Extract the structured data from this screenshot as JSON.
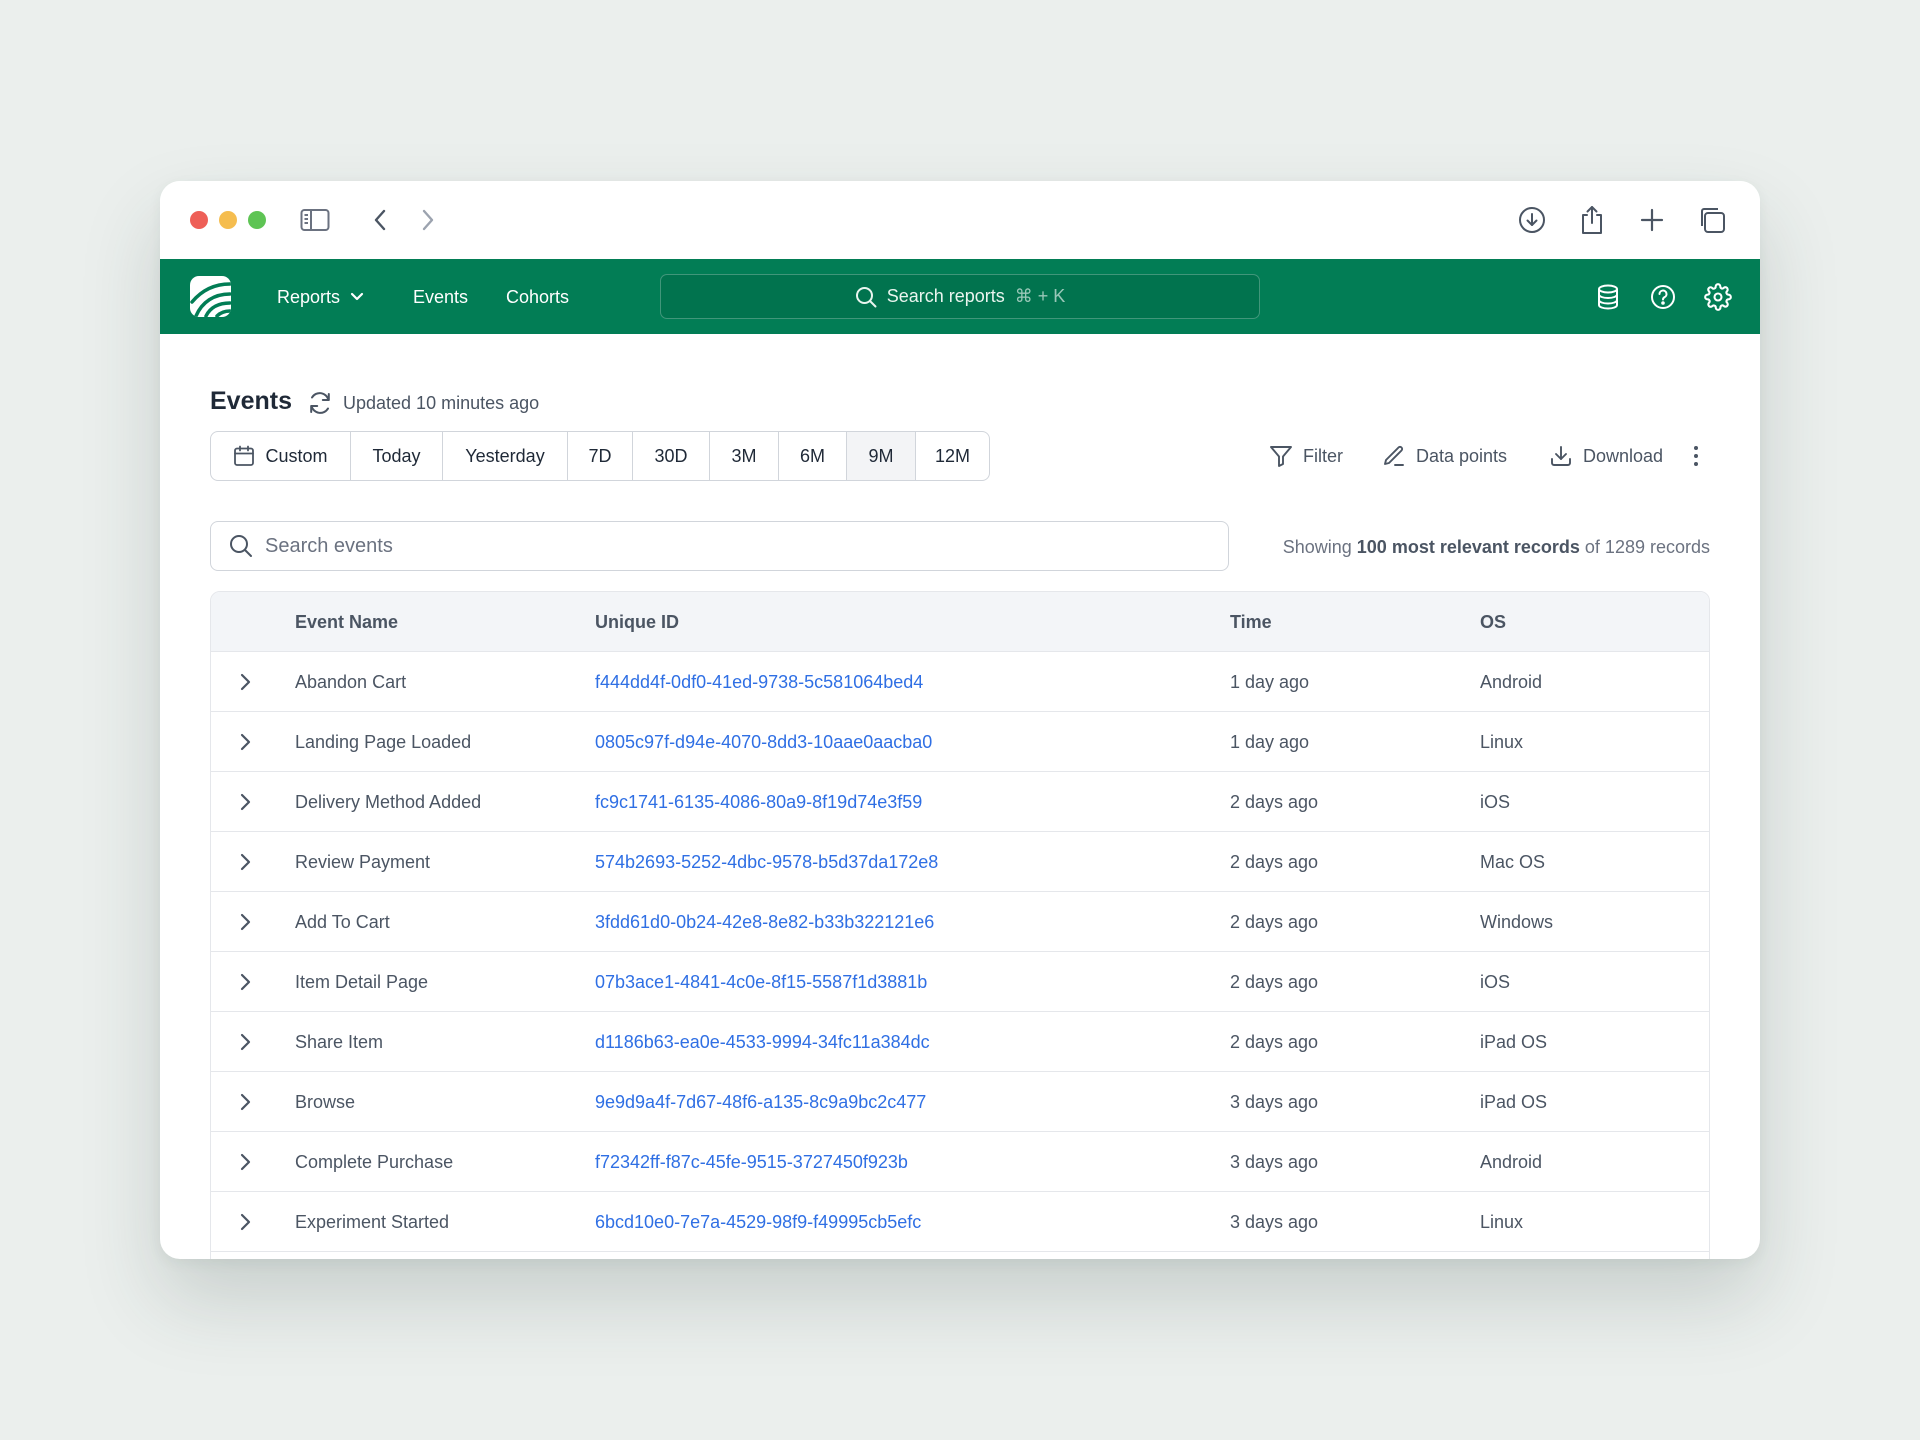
{
  "app": {
    "nav": {
      "reports_label": "Reports",
      "events_label": "Events",
      "cohorts_label": "Cohorts",
      "search_placeholder": "Search reports",
      "search_shortcut": "⌘ + K"
    },
    "brand_color": "#027d55"
  },
  "page": {
    "title": "Events",
    "updated_text": "Updated 10 minutes ago"
  },
  "date_ranges": [
    {
      "label": "Custom",
      "active": false
    },
    {
      "label": "Today",
      "active": false
    },
    {
      "label": "Yesterday",
      "active": false
    },
    {
      "label": "7D",
      "active": false
    },
    {
      "label": "30D",
      "active": false
    },
    {
      "label": "3M",
      "active": false
    },
    {
      "label": "6M",
      "active": false
    },
    {
      "label": "9M",
      "active": true
    },
    {
      "label": "12M",
      "active": false
    }
  ],
  "toolbar": {
    "filter_label": "Filter",
    "data_points_label": "Data points",
    "download_label": "Download"
  },
  "event_search": {
    "placeholder": "Search events"
  },
  "showing": {
    "prefix": "Showing",
    "emphasis": "100 most relevant records",
    "suffix": "of 1289 records"
  },
  "table": {
    "columns": {
      "event_name": "Event Name",
      "unique_id": "Unique ID",
      "time": "Time",
      "os": "OS"
    },
    "rows": [
      {
        "event": "Abandon Cart",
        "id": "f444dd4f-0df0-41ed-9738-5c581064bed4",
        "time": "1 day ago",
        "os": "Android"
      },
      {
        "event": "Landing Page Loaded",
        "id": "0805c97f-d94e-4070-8dd3-10aae0aacba0",
        "time": "1 day ago",
        "os": "Linux"
      },
      {
        "event": "Delivery Method Added",
        "id": "fc9c1741-6135-4086-80a9-8f19d74e3f59",
        "time": "2 days ago",
        "os": "iOS"
      },
      {
        "event": "Review Payment",
        "id": "574b2693-5252-4dbc-9578-b5d37da172e8",
        "time": "2 days ago",
        "os": "Mac OS"
      },
      {
        "event": "Add To Cart",
        "id": "3fdd61d0-0b24-42e8-8e82-b33b322121e6",
        "time": "2 days ago",
        "os": "Windows"
      },
      {
        "event": "Item Detail Page",
        "id": "07b3ace1-4841-4c0e-8f15-5587f1d3881b",
        "time": "2 days ago",
        "os": "iOS"
      },
      {
        "event": "Share Item",
        "id": "d1186b63-ea0e-4533-9994-34fc11a384dc",
        "time": "2 days ago",
        "os": "iPad OS"
      },
      {
        "event": "Browse",
        "id": "9e9d9a4f-7d67-48f6-a135-8c9a9bc2c477",
        "time": "3 days ago",
        "os": "iPad OS"
      },
      {
        "event": "Complete Purchase",
        "id": "f72342ff-f87c-45fe-9515-3727450f923b",
        "time": "3 days ago",
        "os": "Android"
      },
      {
        "event": "Experiment Started",
        "id": "6bcd10e0-7e7a-4529-98f9-f49995cb5efc",
        "time": "3 days ago",
        "os": "Linux"
      }
    ]
  }
}
